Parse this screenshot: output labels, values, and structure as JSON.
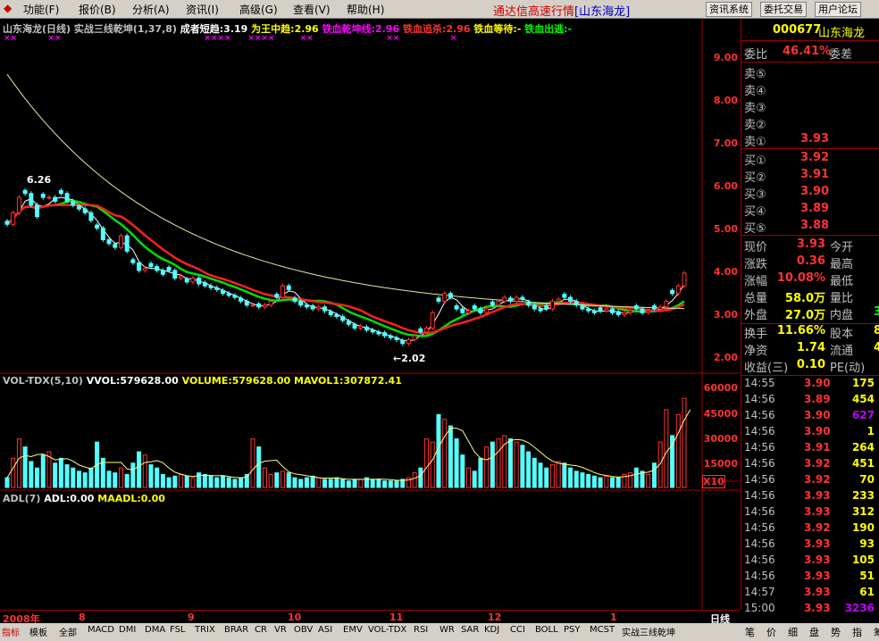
{
  "menu": {
    "items": [
      "功能(F)",
      "报价(B)",
      "分析(A)",
      "资讯(I)",
      "高级(G)",
      "查看(V)",
      "帮助(H)"
    ],
    "title_left": "通达信高速行情",
    "title_right": "[山东海龙]",
    "buttons": [
      "资讯系统",
      "委托交易",
      "用户论坛"
    ]
  },
  "chart_header": {
    "name": "山东海龙(日线)",
    "indicator": "实战三线乾坤(1,37,8)",
    "s1": "成者短趋:3.19",
    "s2": "为王中趋:2.96",
    "s3": "铁血乾坤线:2.96",
    "s4": "铁血追杀:2.96",
    "s5": "铁血等待:-",
    "s6": "铁血出逃:-"
  },
  "price_axis": [
    "9.00",
    "8.00",
    "7.00",
    "6.00",
    "5.00",
    "4.00",
    "3.00",
    "2.00"
  ],
  "annotations": {
    "high": "6.26",
    "low": "←2.02"
  },
  "vol_header": {
    "a": "VOL-TDX(5,10)",
    "b": "VVOL:579628.00",
    "c": "VOLUME:579628.00",
    "d": "MAVOL1:307872.41"
  },
  "vol_axis": [
    "60000",
    "45000",
    "30000",
    "15000"
  ],
  "vol_unit": "X10",
  "adl_header": {
    "a": "ADL(7)",
    "b": "ADL:0.00",
    "c": "MAADL:0.00"
  },
  "date_axis": {
    "labels": [
      "2008年",
      "8",
      "9",
      "10",
      "11",
      "12",
      "1"
    ],
    "period": "日线"
  },
  "bottom_tabs": [
    "指标",
    "模板",
    "全部",
    "MACD",
    "DMI",
    "DMA",
    "FSL",
    "TRIX",
    "BRAR",
    "CR",
    "VR",
    "OBV",
    "ASI",
    "EMV",
    "VOL-TDX",
    "RSI",
    "WR",
    "SAR",
    "KDJ",
    "CCI",
    "BOLL",
    "PSY",
    "MCST",
    "实战三线乾坤"
  ],
  "right_tabs": [
    "笔",
    "价",
    "细",
    "盘",
    "势",
    "指",
    "筹"
  ],
  "quote": {
    "code": "000677",
    "name": "山东海龙",
    "ratio_label": "委比",
    "ratio_value": "46.41%",
    "diff_label": "委差",
    "sell": [
      {
        "label": "卖⑤",
        "price": ""
      },
      {
        "label": "卖④",
        "price": ""
      },
      {
        "label": "卖③",
        "price": ""
      },
      {
        "label": "卖②",
        "price": ""
      },
      {
        "label": "卖①",
        "price": "3.93"
      }
    ],
    "buy": [
      {
        "label": "买①",
        "price": "3.92"
      },
      {
        "label": "买②",
        "price": "3.91"
      },
      {
        "label": "买③",
        "price": "3.90"
      },
      {
        "label": "买④",
        "price": "3.89"
      },
      {
        "label": "买⑤",
        "price": "3.88"
      }
    ],
    "stats": [
      {
        "l1": "现价",
        "v1": "3.93",
        "l2": "今开",
        "v2": ""
      },
      {
        "l1": "涨跌",
        "v1": "0.36",
        "l2": "最高",
        "v2": ""
      },
      {
        "l1": "涨幅",
        "v1": "10.08%",
        "l2": "最低",
        "v2": ""
      },
      {
        "l1": "总量",
        "v1": "58.0万",
        "l2": "量比",
        "v2": ""
      },
      {
        "l1": "外盘",
        "v1": "27.0万",
        "l2": "内盘",
        "v2": "3"
      }
    ],
    "stats2": [
      {
        "l1": "换手",
        "v1": "11.66%",
        "l2": "股本",
        "v2": "8"
      },
      {
        "l1": "净资",
        "v1": "1.74",
        "l2": "流通",
        "v2": "4"
      },
      {
        "l1": "收益(三)",
        "v1": "0.10",
        "l2": "PE(动)",
        "v2": ""
      }
    ]
  },
  "ticks": [
    {
      "time": "14:55",
      "price": "3.90",
      "vol": "175"
    },
    {
      "time": "14:56",
      "price": "3.89",
      "vol": "454"
    },
    {
      "time": "14:56",
      "price": "3.90",
      "vol": "627"
    },
    {
      "time": "14:56",
      "price": "3.90",
      "vol": "1"
    },
    {
      "time": "14:56",
      "price": "3.91",
      "vol": "264"
    },
    {
      "time": "14:56",
      "price": "3.92",
      "vol": "451"
    },
    {
      "time": "14:56",
      "price": "3.92",
      "vol": "70"
    },
    {
      "time": "14:56",
      "price": "3.93",
      "vol": "233"
    },
    {
      "time": "14:56",
      "price": "3.93",
      "vol": "312"
    },
    {
      "time": "14:56",
      "price": "3.92",
      "vol": "190"
    },
    {
      "time": "14:56",
      "price": "3.93",
      "vol": "93"
    },
    {
      "time": "14:56",
      "price": "3.93",
      "vol": "105"
    },
    {
      "time": "14:56",
      "price": "3.93",
      "vol": "51"
    },
    {
      "time": "14:57",
      "price": "3.93",
      "vol": "61"
    },
    {
      "time": "15:00",
      "price": "3.93",
      "vol": "3236"
    }
  ],
  "chart_data": {
    "type": "candlestick",
    "price_range": [
      1.7,
      9.5
    ],
    "volume_range": [
      0,
      65000
    ],
    "close": [
      5.2,
      5.5,
      5.9,
      6.0,
      5.7,
      5.4,
      5.9,
      5.9,
      5.8,
      6.0,
      5.8,
      5.7,
      5.6,
      5.5,
      5.3,
      5.1,
      4.8,
      4.7,
      4.6,
      4.9,
      4.5,
      4.2,
      4.0,
      4.05,
      4.1,
      4.0,
      3.9,
      4.0,
      3.8,
      3.85,
      3.7,
      3.8,
      3.65,
      3.6,
      3.55,
      3.5,
      3.4,
      3.35,
      3.3,
      3.2,
      3.1,
      3.1,
      3.05,
      3.1,
      3.2,
      3.3,
      3.6,
      3.5,
      3.2,
      3.1,
      3.05,
      3.0,
      3.05,
      2.95,
      2.85,
      2.8,
      2.7,
      2.6,
      2.5,
      2.55,
      2.45,
      2.4,
      2.35,
      2.3,
      2.25,
      2.2,
      2.1,
      2.2,
      2.3,
      2.4,
      2.5,
      2.9,
      3.2,
      3.4,
      3.3,
      3.0,
      2.9,
      2.95,
      3.0,
      2.9,
      3.0,
      3.1,
      3.2,
      3.3,
      3.2,
      3.3,
      3.25,
      3.1,
      3.0,
      2.95,
      3.0,
      3.2,
      3.25,
      3.3,
      3.2,
      3.1,
      3.0,
      2.95,
      2.9,
      2.95,
      3.0,
      2.9,
      2.85,
      2.9,
      2.95,
      3.0,
      2.9,
      2.95,
      3.0,
      3.05,
      3.2,
      3.4,
      3.6,
      3.93
    ],
    "volume": [
      6000,
      18000,
      30000,
      25000,
      16000,
      12000,
      20000,
      22000,
      15000,
      18000,
      14000,
      12000,
      10000,
      9000,
      12000,
      28000,
      18000,
      10000,
      9000,
      12000,
      8000,
      15000,
      22000,
      20000,
      14000,
      12000,
      8000,
      6000,
      7000,
      8000,
      7000,
      6000,
      9000,
      8000,
      7000,
      6000,
      7000,
      6000,
      5000,
      6000,
      8000,
      30000,
      25000,
      12000,
      8000,
      9000,
      10000,
      9000,
      6000,
      5000,
      6000,
      7000,
      6000,
      5000,
      5000,
      6000,
      5000,
      4000,
      5000,
      5000,
      6000,
      5000,
      5000,
      4000,
      4000,
      4000,
      5000,
      6000,
      9000,
      12000,
      30000,
      28000,
      45000,
      42000,
      38000,
      30000,
      20000,
      12000,
      10000,
      18000,
      25000,
      28000,
      30000,
      32000,
      30000,
      28000,
      26000,
      22000,
      18000,
      15000,
      12000,
      14000,
      16000,
      15000,
      12000,
      10000,
      9000,
      8000,
      7000,
      6000,
      7000,
      6000,
      6000,
      8000,
      9000,
      12000,
      10000,
      8000,
      15000,
      28000,
      48000,
      32000,
      45000,
      55000,
      60000
    ]
  }
}
